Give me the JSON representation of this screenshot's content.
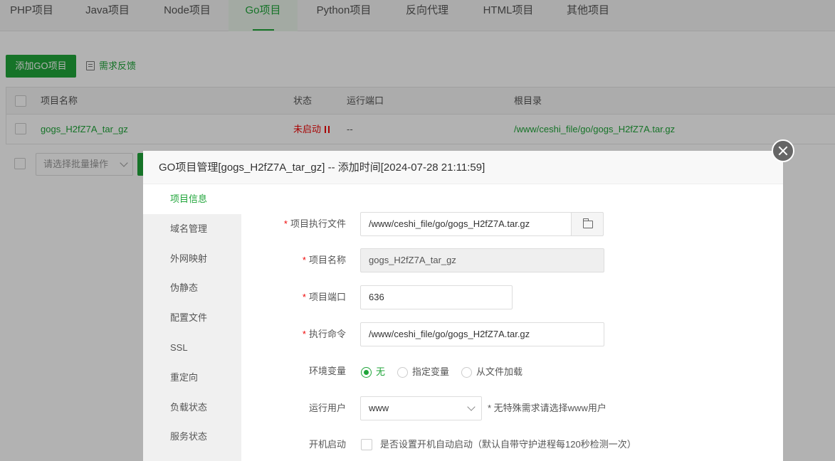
{
  "tabs": [
    {
      "label": "PHP项目"
    },
    {
      "label": "Java项目"
    },
    {
      "label": "Node项目"
    },
    {
      "label": "Go项目"
    },
    {
      "label": "Python项目"
    },
    {
      "label": "反向代理"
    },
    {
      "label": "HTML项目"
    },
    {
      "label": "其他项目"
    }
  ],
  "active_tab": "Go项目",
  "toolbar": {
    "add_label": "添加GO项目",
    "feedback_label": "需求反馈"
  },
  "table": {
    "headers": {
      "name": "项目名称",
      "status": "状态",
      "port": "运行端口",
      "root": "根目录"
    },
    "rows": [
      {
        "name": "gogs_H2fZ7A_tar_gz",
        "status": "未启动",
        "port": "--",
        "root": "/www/ceshi_file/go/gogs_H2fZ7A.tar.gz"
      }
    ]
  },
  "batch": {
    "placeholder": "请选择批量操作"
  },
  "modal": {
    "title": "GO项目管理[gogs_H2fZ7A_tar_gz] -- 添加时间[2024-07-28 21:11:59]",
    "menu": [
      {
        "label": "项目信息"
      },
      {
        "label": "域名管理"
      },
      {
        "label": "外网映射"
      },
      {
        "label": "伪静态"
      },
      {
        "label": "配置文件"
      },
      {
        "label": "SSL"
      },
      {
        "label": "重定向"
      },
      {
        "label": "负载状态"
      },
      {
        "label": "服务状态"
      }
    ],
    "form": {
      "exec_file_label": "项目执行文件",
      "exec_file_value": "/www/ceshi_file/go/gogs_H2fZ7A.tar.gz",
      "name_label": "项目名称",
      "name_value": "gogs_H2fZ7A_tar_gz",
      "port_label": "项目端口",
      "port_value": "636",
      "cmd_label": "执行命令",
      "cmd_value": "/www/ceshi_file/go/gogs_H2fZ7A.tar.gz",
      "env_label": "环境变量",
      "env_options": [
        "无",
        "指定变量",
        "从文件加载"
      ],
      "env_selected": "无",
      "user_label": "运行用户",
      "user_value": "www",
      "user_hint": "* 无特殊需求请选择www用户",
      "boot_label": "开机启动",
      "boot_text": "是否设置开机自动启动（默认自带守护进程每120秒检测一次）"
    }
  },
  "colors": {
    "accent": "#20a53a",
    "danger": "#ef0808"
  }
}
